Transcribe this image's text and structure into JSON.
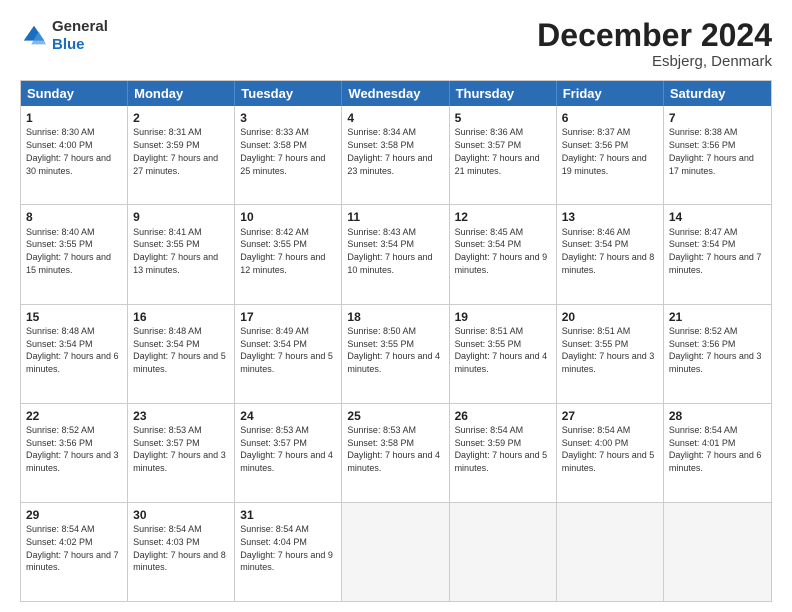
{
  "header": {
    "logo_general": "General",
    "logo_blue": "Blue",
    "month_title": "December 2024",
    "subtitle": "Esbjerg, Denmark"
  },
  "calendar": {
    "days_of_week": [
      "Sunday",
      "Monday",
      "Tuesday",
      "Wednesday",
      "Thursday",
      "Friday",
      "Saturday"
    ],
    "rows": [
      [
        {
          "day": "1",
          "sunrise": "Sunrise: 8:30 AM",
          "sunset": "Sunset: 4:00 PM",
          "daylight": "Daylight: 7 hours and 30 minutes."
        },
        {
          "day": "2",
          "sunrise": "Sunrise: 8:31 AM",
          "sunset": "Sunset: 3:59 PM",
          "daylight": "Daylight: 7 hours and 27 minutes."
        },
        {
          "day": "3",
          "sunrise": "Sunrise: 8:33 AM",
          "sunset": "Sunset: 3:58 PM",
          "daylight": "Daylight: 7 hours and 25 minutes."
        },
        {
          "day": "4",
          "sunrise": "Sunrise: 8:34 AM",
          "sunset": "Sunset: 3:58 PM",
          "daylight": "Daylight: 7 hours and 23 minutes."
        },
        {
          "day": "5",
          "sunrise": "Sunrise: 8:36 AM",
          "sunset": "Sunset: 3:57 PM",
          "daylight": "Daylight: 7 hours and 21 minutes."
        },
        {
          "day": "6",
          "sunrise": "Sunrise: 8:37 AM",
          "sunset": "Sunset: 3:56 PM",
          "daylight": "Daylight: 7 hours and 19 minutes."
        },
        {
          "day": "7",
          "sunrise": "Sunrise: 8:38 AM",
          "sunset": "Sunset: 3:56 PM",
          "daylight": "Daylight: 7 hours and 17 minutes."
        }
      ],
      [
        {
          "day": "8",
          "sunrise": "Sunrise: 8:40 AM",
          "sunset": "Sunset: 3:55 PM",
          "daylight": "Daylight: 7 hours and 15 minutes."
        },
        {
          "day": "9",
          "sunrise": "Sunrise: 8:41 AM",
          "sunset": "Sunset: 3:55 PM",
          "daylight": "Daylight: 7 hours and 13 minutes."
        },
        {
          "day": "10",
          "sunrise": "Sunrise: 8:42 AM",
          "sunset": "Sunset: 3:55 PM",
          "daylight": "Daylight: 7 hours and 12 minutes."
        },
        {
          "day": "11",
          "sunrise": "Sunrise: 8:43 AM",
          "sunset": "Sunset: 3:54 PM",
          "daylight": "Daylight: 7 hours and 10 minutes."
        },
        {
          "day": "12",
          "sunrise": "Sunrise: 8:45 AM",
          "sunset": "Sunset: 3:54 PM",
          "daylight": "Daylight: 7 hours and 9 minutes."
        },
        {
          "day": "13",
          "sunrise": "Sunrise: 8:46 AM",
          "sunset": "Sunset: 3:54 PM",
          "daylight": "Daylight: 7 hours and 8 minutes."
        },
        {
          "day": "14",
          "sunrise": "Sunrise: 8:47 AM",
          "sunset": "Sunset: 3:54 PM",
          "daylight": "Daylight: 7 hours and 7 minutes."
        }
      ],
      [
        {
          "day": "15",
          "sunrise": "Sunrise: 8:48 AM",
          "sunset": "Sunset: 3:54 PM",
          "daylight": "Daylight: 7 hours and 6 minutes."
        },
        {
          "day": "16",
          "sunrise": "Sunrise: 8:48 AM",
          "sunset": "Sunset: 3:54 PM",
          "daylight": "Daylight: 7 hours and 5 minutes."
        },
        {
          "day": "17",
          "sunrise": "Sunrise: 8:49 AM",
          "sunset": "Sunset: 3:54 PM",
          "daylight": "Daylight: 7 hours and 5 minutes."
        },
        {
          "day": "18",
          "sunrise": "Sunrise: 8:50 AM",
          "sunset": "Sunset: 3:55 PM",
          "daylight": "Daylight: 7 hours and 4 minutes."
        },
        {
          "day": "19",
          "sunrise": "Sunrise: 8:51 AM",
          "sunset": "Sunset: 3:55 PM",
          "daylight": "Daylight: 7 hours and 4 minutes."
        },
        {
          "day": "20",
          "sunrise": "Sunrise: 8:51 AM",
          "sunset": "Sunset: 3:55 PM",
          "daylight": "Daylight: 7 hours and 3 minutes."
        },
        {
          "day": "21",
          "sunrise": "Sunrise: 8:52 AM",
          "sunset": "Sunset: 3:56 PM",
          "daylight": "Daylight: 7 hours and 3 minutes."
        }
      ],
      [
        {
          "day": "22",
          "sunrise": "Sunrise: 8:52 AM",
          "sunset": "Sunset: 3:56 PM",
          "daylight": "Daylight: 7 hours and 3 minutes."
        },
        {
          "day": "23",
          "sunrise": "Sunrise: 8:53 AM",
          "sunset": "Sunset: 3:57 PM",
          "daylight": "Daylight: 7 hours and 3 minutes."
        },
        {
          "day": "24",
          "sunrise": "Sunrise: 8:53 AM",
          "sunset": "Sunset: 3:57 PM",
          "daylight": "Daylight: 7 hours and 4 minutes."
        },
        {
          "day": "25",
          "sunrise": "Sunrise: 8:53 AM",
          "sunset": "Sunset: 3:58 PM",
          "daylight": "Daylight: 7 hours and 4 minutes."
        },
        {
          "day": "26",
          "sunrise": "Sunrise: 8:54 AM",
          "sunset": "Sunset: 3:59 PM",
          "daylight": "Daylight: 7 hours and 5 minutes."
        },
        {
          "day": "27",
          "sunrise": "Sunrise: 8:54 AM",
          "sunset": "Sunset: 4:00 PM",
          "daylight": "Daylight: 7 hours and 5 minutes."
        },
        {
          "day": "28",
          "sunrise": "Sunrise: 8:54 AM",
          "sunset": "Sunset: 4:01 PM",
          "daylight": "Daylight: 7 hours and 6 minutes."
        }
      ],
      [
        {
          "day": "29",
          "sunrise": "Sunrise: 8:54 AM",
          "sunset": "Sunset: 4:02 PM",
          "daylight": "Daylight: 7 hours and 7 minutes."
        },
        {
          "day": "30",
          "sunrise": "Sunrise: 8:54 AM",
          "sunset": "Sunset: 4:03 PM",
          "daylight": "Daylight: 7 hours and 8 minutes."
        },
        {
          "day": "31",
          "sunrise": "Sunrise: 8:54 AM",
          "sunset": "Sunset: 4:04 PM",
          "daylight": "Daylight: 7 hours and 9 minutes."
        },
        null,
        null,
        null,
        null
      ]
    ]
  }
}
